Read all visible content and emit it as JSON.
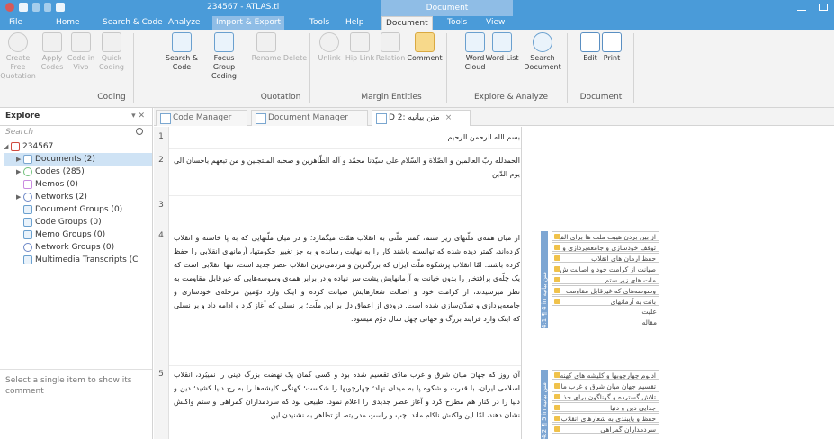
{
  "window": {
    "title": "234567 - ATLAS.ti",
    "context_header": "Document"
  },
  "ribbon_tabs": [
    "File",
    "Home",
    "Search & Code",
    "Analyze",
    "Import & Export",
    "Tools",
    "Help",
    "Document",
    "Tools",
    "View"
  ],
  "ribbon": {
    "buttons": [
      {
        "label": "Create Free Quotation",
        "enabled": false
      },
      {
        "label": "Apply Codes",
        "enabled": false
      },
      {
        "label": "Code in Vivo",
        "enabled": false
      },
      {
        "label": "Quick Coding",
        "enabled": false
      },
      {
        "label": "Search & Code",
        "enabled": true
      },
      {
        "label": "Focus Group Coding",
        "enabled": true
      },
      {
        "label": "Rename",
        "enabled": false
      },
      {
        "label": "Delete",
        "enabled": false
      },
      {
        "label": "Unlink",
        "enabled": false
      },
      {
        "label": "Hip Link",
        "enabled": false
      },
      {
        "label": "Relation",
        "enabled": false
      },
      {
        "label": "Comment",
        "enabled": true
      },
      {
        "label": "Word Cloud",
        "enabled": true
      },
      {
        "label": "Word List",
        "enabled": true
      },
      {
        "label": "Search Document",
        "enabled": true
      },
      {
        "label": "Edit",
        "enabled": true
      },
      {
        "label": "Print",
        "enabled": true
      }
    ],
    "groups": [
      "Coding",
      "Quotation",
      "Margin Entities",
      "Explore & Analyze",
      "Document"
    ]
  },
  "explore": {
    "title": "Explore",
    "controls": "▾ ✕",
    "search_placeholder": "Search",
    "tree": [
      {
        "label": "234567",
        "indent": 0,
        "caret": "◢",
        "kind": "proj"
      },
      {
        "label": "Documents (2)",
        "indent": 1,
        "caret": "▶",
        "kind": "docs",
        "selected": true
      },
      {
        "label": "Codes (285)",
        "indent": 1,
        "caret": "▶",
        "kind": "codes"
      },
      {
        "label": "Memos (0)",
        "indent": 1,
        "caret": "",
        "kind": "memos"
      },
      {
        "label": "Networks (2)",
        "indent": 1,
        "caret": "▶",
        "kind": "net"
      },
      {
        "label": "Document Groups (0)",
        "indent": 1,
        "caret": "",
        "kind": "grp"
      },
      {
        "label": "Code Groups (0)",
        "indent": 1,
        "caret": "",
        "kind": "grp"
      },
      {
        "label": "Memo Groups (0)",
        "indent": 1,
        "caret": "",
        "kind": "grp"
      },
      {
        "label": "Network Groups (0)",
        "indent": 1,
        "caret": "",
        "kind": "net"
      },
      {
        "label": "Multimedia Transcripts (C",
        "indent": 1,
        "caret": "",
        "kind": "grp"
      }
    ],
    "comment_hint": "Select a single item to show its comment"
  },
  "doc_tabs": [
    {
      "label": "Code Manager",
      "active": false
    },
    {
      "label": "Document Manager",
      "active": false
    },
    {
      "label": "D 2: متن بیانیه",
      "active": true
    }
  ],
  "document": {
    "line_numbers": [
      "1",
      "2",
      "3",
      "4",
      "5"
    ],
    "paragraphs": [
      "بسم الله الرحمن الرحیم",
      "الحمدلله ربّ العالمین و الصّلاة و السّلام علی سیّدنا محمّد و آله الطّاهرین و صحبه المنتجبین و من تبعهم باحسان الی یوم الدّین",
      "",
      "از میان همه‌ی ملّتهای زیر ستم، کمتر ملّتی به انقلاب همّت میگمارد؛ و در میان ملّتهایی که به پا خاسته و انقلاب کرده‌اند، کمتر دیده شده که توانسته باشند کار را به نهایت رسانده و به جز تغییر حکومتها، آرمانهای انقلابی را حفظ کرده باشند. امّا انقلاب پرشکوه ملّت ایران که بزرگترین و مردمی‌ترین انقلاب عصر جدید است، تنها انقلابی است که یک چلّه‌ی پرافتخار را بدون خیانت به آرمانهایش پشت سر نهاده و در برابر همه‌ی وسوسه‌هایی که غیرقابل مقاومت به نظر میرسیدند، از کرامت خود و اصالت شعارهایش صیانت کرده و اینک وارد دوّمین مرحله‌ی خودسازی و جامعه‌پردازی و تمدّن‌سازی شده است. درودی از اعماق دل بر این ملّت؛ بر نسلی که آغاز کرد و ادامه داد و بر نسلی که اینک وارد فرایند بزرگ و جهانی چهل سال دوّم میشود.",
      "آن روز که جهان میان شرق و غرب مادّی تقسیم شده بود و کسی گمان یک نهضت بزرگ دینی را نمیبُرد، انقلاب اسلامی ایران، با قدرت و شکوه پا به میدان نهاد؛ چهارچوبها را شکست؛ کهنگی کلیشه‌ها را به رخ دنیا کشید؛ دین و دنیا را در کنار هم مطرح کرد و آغاز عصر جدیدی را اعلام نمود. طبیعی بود که سردمداران گمراهی و ستم واکنش نشان دهند، امّا این واکنش ناکام ماند. چپ و راستِ مدرنیته، از تظاهر به نشنیدن این"
    ]
  },
  "margin": {
    "quotations": [
      {
        "label": "4:1 ¶ 4 in متن بیانیه",
        "codes": [
          "از بین بردن هیبت ملت ها برای الف",
          "توقف خودسازی و جامعه‌پردازی و",
          "حفظ آرمان های انقلاب",
          "صیانت از کرامت خود و اصالت ش",
          "ملت های زیر ستم",
          "وسوسه‌های که غیرقابل مقاومت",
          "بانت به آرمانهای",
          "علیت",
          "مقاله"
        ],
        "plain_from": 7
      },
      {
        "label": "4:2 ¶ 5 in متن بیانیه",
        "codes": [
          "ادلوم چهارچوبها و کلیشه های کهنه",
          "تقسیم جهان میان شرق و غرب ما",
          "تلاش گسترده و گوناگون برای حذ",
          "جدایی دین و دنیا",
          "حفظ و پایبندی به شعارهای انقلاب",
          "سردمداران گمراهی"
        ],
        "plain_from": 99
      }
    ]
  }
}
